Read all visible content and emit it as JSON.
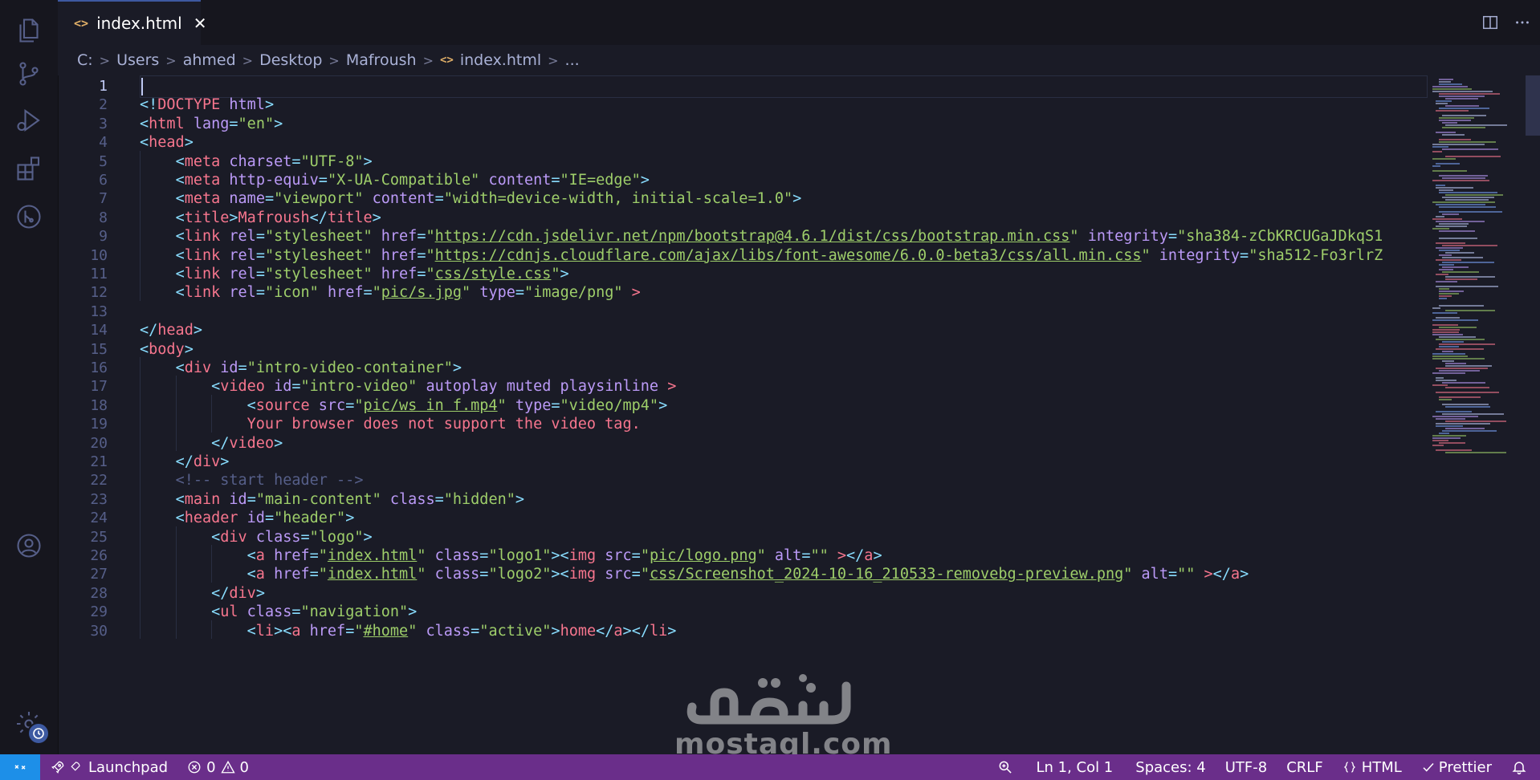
{
  "tab": {
    "label": "index.html",
    "close": "✕"
  },
  "breadcrumb": [
    "C:",
    "Users",
    "ahmed",
    "Desktop",
    "Mafroush",
    "index.html",
    "..."
  ],
  "editor": {
    "line_numbers": [
      "1",
      "2",
      "3",
      "4",
      "5",
      "6",
      "7",
      "8",
      "9",
      "10",
      "11",
      "12",
      "13",
      "14",
      "15",
      "16",
      "17",
      "18",
      "19",
      "20",
      "21",
      "22",
      "23",
      "24",
      "25",
      "26",
      "27",
      "28",
      "29",
      "30"
    ],
    "active_line": "1",
    "lines": [
      "",
      "<!DOCTYPE html>",
      "<html lang=\"en\">",
      "<head>",
      "    <meta charset=\"UTF-8\">",
      "    <meta http-equiv=\"X-UA-Compatible\" content=\"IE=edge\">",
      "    <meta name=\"viewport\" content=\"width=device-width, initial-scale=1.0\">",
      "    <title>Mafroush</title>",
      "    <link rel=\"stylesheet\" href=\"https://cdn.jsdelivr.net/npm/bootstrap@4.6.1/dist/css/bootstrap.min.css\" integrity=\"sha384-zCbKRCUGaJDkqS1",
      "    <link rel=\"stylesheet\" href=\"https://cdnjs.cloudflare.com/ajax/libs/font-awesome/6.0.0-beta3/css/all.min.css\" integrity=\"sha512-Fo3rlrZ",
      "    <link rel=\"stylesheet\" href=\"css/style.css\">",
      "    <link rel=\"icon\" href=\"pic/s.jpg\" type=\"image/png\" >",
      "",
      "</head>",
      "<body>",
      "    <div id=\"intro-video-container\">",
      "        <video id=\"intro-video\" autoplay muted playsinline >",
      "            <source src=\"pic/ws in f.mp4\" type=\"video/mp4\">",
      "            Your browser does not support the video tag.",
      "        </video>",
      "    </div>",
      "    <!-- start header -->",
      "    <main id=\"main-content\" class=\"hidden\">",
      "    <header id=\"header\">",
      "        <div class=\"logo\">",
      "            <a href=\"index.html\" class=\"logo1\"><img src=\"pic/logo.png\" alt=\"\" ></a>",
      "            <a href=\"index.html\" class=\"logo2\"><img src=\"css/Screenshot_2024-10-16_210533-removebg-preview.png\" alt=\"\" ></a>",
      "        </div>",
      "        <ul class=\"navigation\">",
      "            <li><a href=\"#home\" class=\"active\">home</a></li>"
    ]
  },
  "watermark": {
    "text": "mostaql.com"
  },
  "statusbar": {
    "launchpad": "Launchpad",
    "errors": "0",
    "warnings": "0",
    "position": "Ln 1, Col 1",
    "spaces": "Spaces: 4",
    "encoding": "UTF-8",
    "eol": "CRLF",
    "language": "HTML",
    "formatter": "Prettier"
  },
  "colors": {
    "editor_bg": "#1a1b26",
    "tag": "#f7768e",
    "attribute": "#bb9af7",
    "string": "#9ece6a",
    "statusbar_bg": "#6a2e8a",
    "remote_bg": "#1d8fe8"
  },
  "icons": [
    "files-icon",
    "source-control-icon",
    "run-debug-icon",
    "extensions-icon",
    "git-graph-icon",
    "account-icon",
    "settings-gear-icon",
    "split-editor-icon",
    "more-actions-icon",
    "remote-icon",
    "launchpad-rocket-icon",
    "error-icon",
    "warning-icon",
    "zoom-icon",
    "braces-icon",
    "check-icon",
    "bell-icon"
  ]
}
